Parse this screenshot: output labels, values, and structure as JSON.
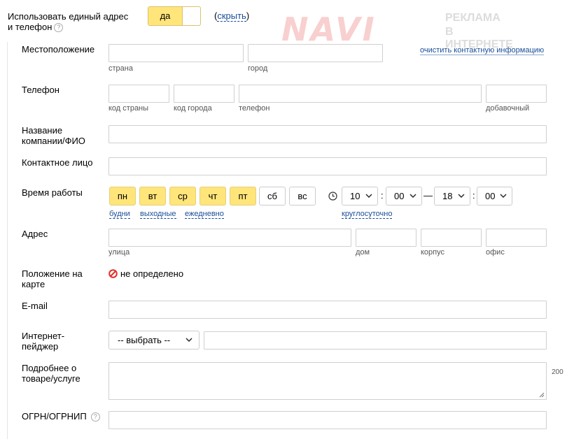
{
  "header": {
    "unified_label": "Использовать единый адрес и телефон",
    "toggle_value": "да",
    "hide_prefix": "(",
    "hide_link": "скрыть",
    "hide_suffix": ")",
    "watermark_big": "NAVI",
    "watermark_line1": "РЕКЛАМА",
    "watermark_line2": "В ИНТЕРНЕТЕ"
  },
  "location": {
    "label": "Местоположение",
    "country_hint": "страна",
    "city_hint": "город",
    "clear_link": "очистить контактную информацию"
  },
  "phone": {
    "label": "Телефон",
    "country_code_hint": "код страны",
    "city_code_hint": "код города",
    "number_hint": "телефон",
    "ext_hint": "добавочный"
  },
  "company": {
    "label": "Название компании/ФИО"
  },
  "contact_person": {
    "label": "Контактное лицо"
  },
  "work_time": {
    "label": "Время работы",
    "days": [
      {
        "label": "пн",
        "active": true
      },
      {
        "label": "вт",
        "active": true
      },
      {
        "label": "ср",
        "active": true
      },
      {
        "label": "чт",
        "active": true
      },
      {
        "label": "пт",
        "active": true
      },
      {
        "label": "сб",
        "active": false
      },
      {
        "label": "вс",
        "active": false
      }
    ],
    "preset_weekdays": "будни",
    "preset_weekends": "выходные",
    "preset_daily": "ежедневно",
    "from_hour": "10",
    "from_minute": "00",
    "dash": "—",
    "to_hour": "18",
    "to_minute": "00",
    "colon": ":",
    "around_clock": "круглосуточно"
  },
  "address": {
    "label": "Адрес",
    "street_hint": "улица",
    "house_hint": "дом",
    "building_hint": "корпус",
    "office_hint": "офис"
  },
  "map_position": {
    "label": "Положение на карте",
    "status": "не определено",
    "status_color": "#e0302a"
  },
  "email": {
    "label": "E-mail"
  },
  "messenger": {
    "label": "Интернет-пейджер",
    "select_value": "-- выбрать --"
  },
  "details": {
    "label": "Подробнее о товаре/услуге",
    "counter": "200"
  },
  "ogrn": {
    "label": "ОГРН/ОГРНИП"
  },
  "colors": {
    "accent_yellow": "#ffe57a",
    "link_blue": "#1a4d99",
    "watermark_red": "#e0302a"
  }
}
